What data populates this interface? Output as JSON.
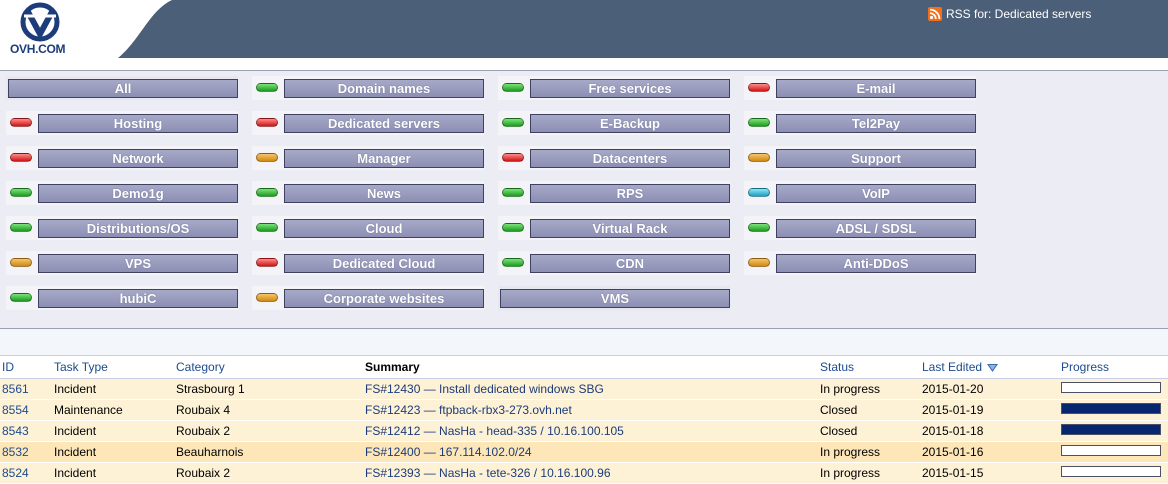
{
  "header": {
    "logo_text": "OVH.COM",
    "rss_label": "RSS for: Dedicated servers"
  },
  "categories": [
    {
      "label": "All",
      "status": null
    },
    {
      "label": "Domain names",
      "status": "green"
    },
    {
      "label": "Free services",
      "status": "green"
    },
    {
      "label": "E-mail",
      "status": "red"
    },
    {
      "label": "Hosting",
      "status": "red"
    },
    {
      "label": "Dedicated servers",
      "status": "red"
    },
    {
      "label": "E-Backup",
      "status": "green"
    },
    {
      "label": "Tel2Pay",
      "status": "green"
    },
    {
      "label": "Network",
      "status": "red"
    },
    {
      "label": "Manager",
      "status": "orange"
    },
    {
      "label": "Datacenters",
      "status": "red"
    },
    {
      "label": "Support",
      "status": "orange"
    },
    {
      "label": "Demo1g",
      "status": "green"
    },
    {
      "label": "News",
      "status": "green"
    },
    {
      "label": "RPS",
      "status": "green"
    },
    {
      "label": "VoIP",
      "status": "blue"
    },
    {
      "label": "Distributions/OS",
      "status": "green"
    },
    {
      "label": "Cloud",
      "status": "green"
    },
    {
      "label": "Virtual Rack",
      "status": "green"
    },
    {
      "label": "ADSL / SDSL",
      "status": "green"
    },
    {
      "label": "VPS",
      "status": "orange"
    },
    {
      "label": "Dedicated Cloud",
      "status": "red"
    },
    {
      "label": "CDN",
      "status": "green"
    },
    {
      "label": "Anti-DDoS",
      "status": "orange"
    },
    {
      "label": "hubiC",
      "status": "green"
    },
    {
      "label": "Corporate websites",
      "status": "orange"
    },
    {
      "label": "VMS",
      "status": null
    }
  ],
  "table": {
    "columns": {
      "id": "ID",
      "task_type": "Task Type",
      "category": "Category",
      "summary": "Summary",
      "status": "Status",
      "last_edited": "Last Edited",
      "progress": "Progress"
    },
    "rows": [
      {
        "id": "8561",
        "task_type": "Incident",
        "category": "Strasbourg 1",
        "summary": "FS#12430 — Install dedicated windows SBG",
        "status": "In progress",
        "last_edited": "2015-01-20",
        "progress": 0
      },
      {
        "id": "8554",
        "task_type": "Maintenance",
        "category": "Roubaix 4",
        "summary": "FS#12423 — ftpback-rbx3-273.ovh.net",
        "status": "Closed",
        "last_edited": "2015-01-19",
        "progress": 100
      },
      {
        "id": "8543",
        "task_type": "Incident",
        "category": "Roubaix 2",
        "summary": "FS#12412 — NasHa - head-335 / 10.16.100.105",
        "status": "Closed",
        "last_edited": "2015-01-18",
        "progress": 100
      },
      {
        "id": "8532",
        "task_type": "Incident",
        "category": "Beauharnois",
        "summary": "FS#12400 — 167.114.102.0/24",
        "status": "In progress",
        "last_edited": "2015-01-16",
        "progress": 0
      },
      {
        "id": "8524",
        "task_type": "Incident",
        "category": "Roubaix 2",
        "summary": "FS#12393 — NasHa - tete-326 / 10.16.100.96",
        "status": "In progress",
        "last_edited": "2015-01-15",
        "progress": 0
      }
    ]
  }
}
